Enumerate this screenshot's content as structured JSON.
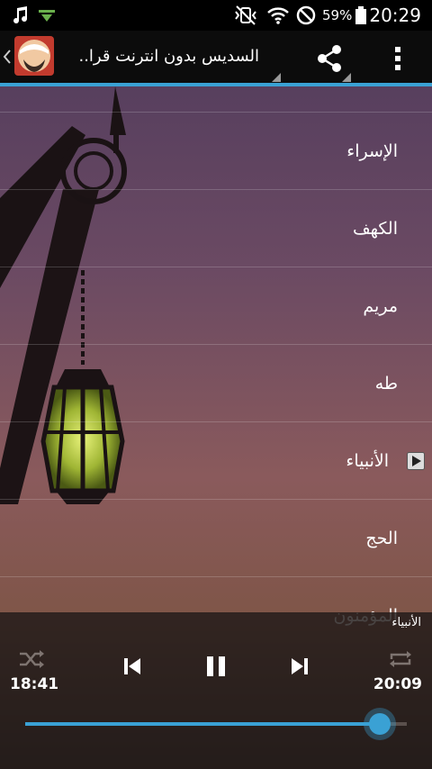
{
  "status_bar": {
    "battery_percent": "59%",
    "time": "20:29",
    "icons": [
      "music-note-icon",
      "download-arrow-icon",
      "vibrate-mute-icon",
      "wifi-icon",
      "do-not-disturb-icon",
      "battery-icon"
    ]
  },
  "app_bar": {
    "title": "السديس بدون انترنت قرا..",
    "icons": [
      "back-chevron-icon",
      "app-avatar-icon",
      "share-icon",
      "overflow-menu-icon"
    ]
  },
  "list": {
    "items": [
      {
        "label": "الإسراء",
        "playing": false
      },
      {
        "label": "الكهف",
        "playing": false
      },
      {
        "label": "مريم",
        "playing": false
      },
      {
        "label": "طه",
        "playing": false
      },
      {
        "label": "الأنبياء",
        "playing": true
      },
      {
        "label": "الحج",
        "playing": false
      },
      {
        "label": "المؤمنون",
        "playing": false
      }
    ]
  },
  "player": {
    "now_playing": "الأنبياء",
    "elapsed": "18:41",
    "duration": "20:09",
    "progress": 0.93
  },
  "colors": {
    "accent": "#3aa1d4",
    "appbar_bg": "#0c0c0c",
    "statusbar_bg": "#000000"
  }
}
